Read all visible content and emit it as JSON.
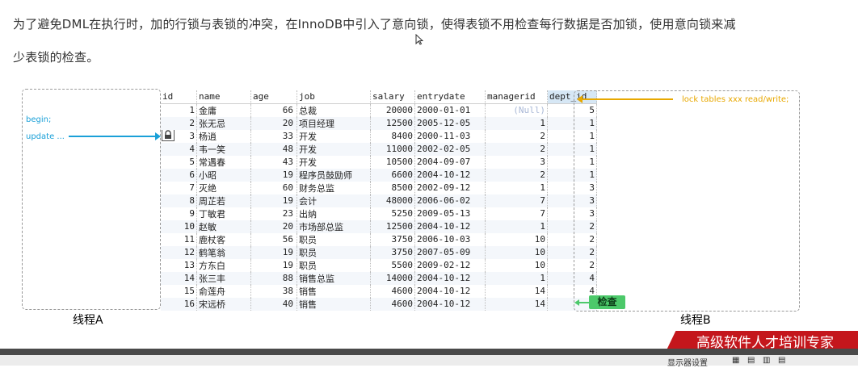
{
  "text": {
    "line1": "为了避免DML在执行时，加的行锁与表锁的冲突，在InnoDB中引入了意向锁，使得表锁不用检查每行数据是否加锁，使用意向锁来减",
    "line2": "少表锁的检查。"
  },
  "threadA": {
    "label": "线程A",
    "begin": "begin;",
    "update": "update ..."
  },
  "threadB": {
    "label": "线程B",
    "lock_cmd": "lock tables xxx read/write;",
    "check_label": "检查"
  },
  "table": {
    "columns": [
      "id",
      "name",
      "age",
      "job",
      "salary",
      "entrydate",
      "managerid",
      "dept_id"
    ],
    "selected_column": "dept_id",
    "null_text": "(Null)",
    "rows": [
      [
        "1",
        "金庸",
        "66",
        "总裁",
        "20000",
        "2000-01-01",
        null,
        "5"
      ],
      [
        "2",
        "张无忌",
        "20",
        "项目经理",
        "12500",
        "2005-12-05",
        "1",
        "1"
      ],
      [
        "3",
        "杨逍",
        "33",
        "开发",
        "8400",
        "2000-11-03",
        "2",
        "1"
      ],
      [
        "4",
        "韦一笑",
        "48",
        "开发",
        "11000",
        "2002-02-05",
        "2",
        "1"
      ],
      [
        "5",
        "常遇春",
        "43",
        "开发",
        "10500",
        "2004-09-07",
        "3",
        "1"
      ],
      [
        "6",
        "小昭",
        "19",
        "程序员鼓励师",
        "6600",
        "2004-10-12",
        "2",
        "1"
      ],
      [
        "7",
        "灭绝",
        "60",
        "财务总监",
        "8500",
        "2002-09-12",
        "1",
        "3"
      ],
      [
        "8",
        "周芷若",
        "19",
        "会计",
        "48000",
        "2006-06-02",
        "7",
        "3"
      ],
      [
        "9",
        "丁敏君",
        "23",
        "出纳",
        "5250",
        "2009-05-13",
        "7",
        "3"
      ],
      [
        "10",
        "赵敏",
        "20",
        "市场部总监",
        "12500",
        "2004-10-12",
        "1",
        "2"
      ],
      [
        "11",
        "鹿杖客",
        "56",
        "职员",
        "3750",
        "2006-10-03",
        "10",
        "2"
      ],
      [
        "12",
        "鹤笔翁",
        "19",
        "职员",
        "3750",
        "2007-05-09",
        "10",
        "2"
      ],
      [
        "13",
        "方东白",
        "19",
        "职员",
        "5500",
        "2009-02-12",
        "10",
        "2"
      ],
      [
        "14",
        "张三丰",
        "88",
        "销售总监",
        "14000",
        "2004-10-12",
        "1",
        "4"
      ],
      [
        "15",
        "俞莲舟",
        "38",
        "销售",
        "4600",
        "2004-10-12",
        "14",
        "4"
      ],
      [
        "16",
        "宋远桥",
        "40",
        "销售",
        "4600",
        "2004-10-12",
        "14",
        "4"
      ]
    ]
  },
  "footer": {
    "banner": "高级软件人才培训专家",
    "display_settings": "显示器设置"
  },
  "colors": {
    "blue": "#1aa0d8",
    "orange": "#e8a800",
    "green": "#4cc96a",
    "banner_red": "#c4161c"
  }
}
